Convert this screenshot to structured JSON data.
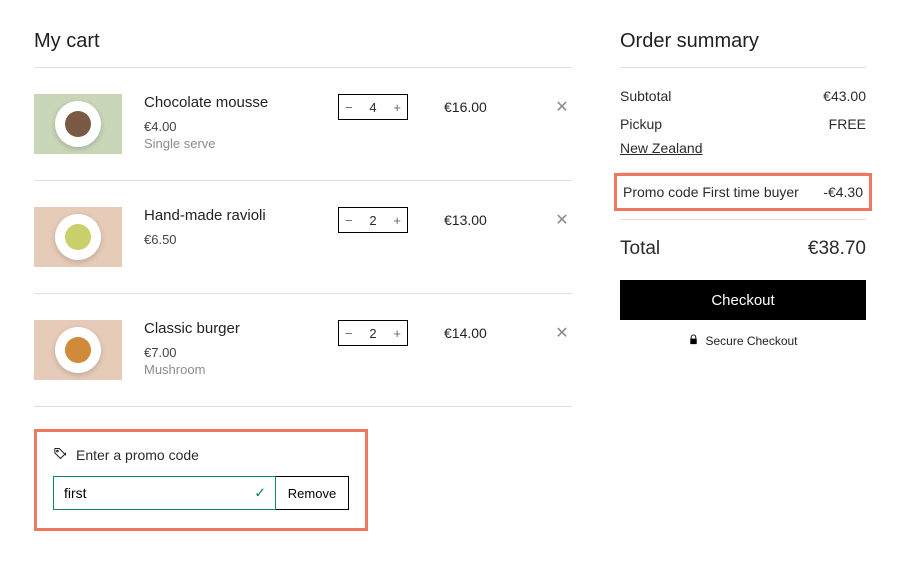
{
  "cart": {
    "title": "My cart",
    "items": [
      {
        "name": "Chocolate mousse",
        "unit_price": "€4.00",
        "variant": "Single serve",
        "qty": "4",
        "line_total": "€16.00",
        "thumb_bg": "#c9d6b8",
        "food_color": "#7a5a44"
      },
      {
        "name": "Hand-made ravioli",
        "unit_price": "€6.50",
        "variant": "",
        "qty": "2",
        "line_total": "€13.00",
        "thumb_bg": "#e6cbb8",
        "food_color": "#c9cf6a"
      },
      {
        "name": "Classic burger",
        "unit_price": "€7.00",
        "variant": "Mushroom",
        "qty": "2",
        "line_total": "€14.00",
        "thumb_bg": "#e6cbb8",
        "food_color": "#d18a3a"
      }
    ],
    "promo": {
      "label": "Enter a promo code",
      "value": "first",
      "remove_label": "Remove"
    }
  },
  "summary": {
    "title": "Order summary",
    "subtotal_label": "Subtotal",
    "subtotal_value": "€43.00",
    "pickup_label": "Pickup",
    "pickup_value": "FREE",
    "location": "New Zealand",
    "promo_label": "Promo code First time buyer",
    "promo_value": "-€4.30",
    "total_label": "Total",
    "total_value": "€38.70",
    "checkout_label": "Checkout",
    "secure_label": "Secure Checkout"
  }
}
